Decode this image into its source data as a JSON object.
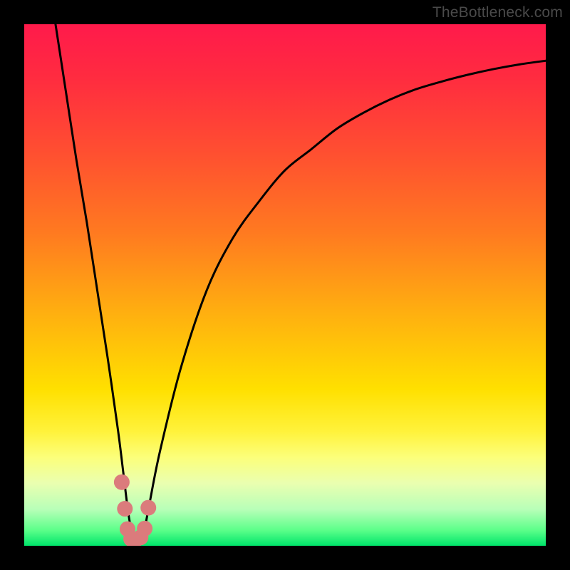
{
  "watermark": "TheBottleneck.com",
  "colors": {
    "frame": "#000000",
    "curve_stroke": "#000000",
    "marker_fill": "#db7b7c",
    "gradient_stops": [
      {
        "offset": 0.0,
        "color": "#ff1a4b"
      },
      {
        "offset": 0.1,
        "color": "#ff2b40"
      },
      {
        "offset": 0.25,
        "color": "#ff5030"
      },
      {
        "offset": 0.4,
        "color": "#ff7a20"
      },
      {
        "offset": 0.55,
        "color": "#ffae10"
      },
      {
        "offset": 0.7,
        "color": "#ffe000"
      },
      {
        "offset": 0.78,
        "color": "#fff23a"
      },
      {
        "offset": 0.83,
        "color": "#fcff7a"
      },
      {
        "offset": 0.88,
        "color": "#eaffb0"
      },
      {
        "offset": 0.93,
        "color": "#b8ffb8"
      },
      {
        "offset": 0.97,
        "color": "#5cff8a"
      },
      {
        "offset": 1.0,
        "color": "#00e56a"
      }
    ]
  },
  "chart_data": {
    "type": "line",
    "title": "",
    "xlabel": "",
    "ylabel": "",
    "xlim": [
      0,
      100
    ],
    "ylim": [
      0,
      100
    ],
    "notes": "Vertical gradient background from red (top = high bottleneck) through orange/yellow to green (bottom = no bottleneck). A single black V-shaped curve drops steeply from top-left to a minimum near x≈21 at y≈0, then rises asymptotically toward the upper-right. Salmon-colored markers cluster at the curve's trough.",
    "series": [
      {
        "name": "bottleneck-curve",
        "x": [
          6,
          8,
          10,
          12,
          14,
          16,
          18,
          19,
          20,
          21,
          22,
          23,
          24,
          26,
          30,
          35,
          40,
          45,
          50,
          55,
          60,
          65,
          70,
          75,
          80,
          85,
          90,
          95,
          100
        ],
        "y": [
          100,
          87,
          74,
          62,
          49,
          36,
          22,
          14,
          6,
          1,
          1,
          3,
          8,
          18,
          34,
          49,
          59,
          66,
          72,
          76,
          80,
          83,
          85.5,
          87.5,
          89,
          90.3,
          91.4,
          92.3,
          93
        ]
      }
    ],
    "markers": [
      {
        "x": 18.7,
        "y": 12.2
      },
      {
        "x": 19.3,
        "y": 7.1
      },
      {
        "x": 19.8,
        "y": 3.2
      },
      {
        "x": 20.5,
        "y": 1.3
      },
      {
        "x": 21.4,
        "y": 1.2
      },
      {
        "x": 22.3,
        "y": 1.6
      },
      {
        "x": 23.1,
        "y": 3.3
      },
      {
        "x": 23.8,
        "y": 7.3
      }
    ]
  }
}
